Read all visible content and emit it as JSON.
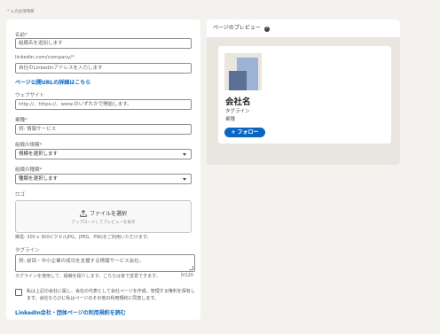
{
  "required_note": "* 入力必須項目",
  "form": {
    "name_label": "名前*",
    "name_placeholder": "組織名を追加します",
    "url_label": "linkedin.com/company/*",
    "url_placeholder": "自社のLinkedInアドレスを入力します",
    "url_details_link": "ページ公開URLの詳細はこちら",
    "website_label": "ウェブサイト",
    "website_placeholder": "http://、https://、www.のいずれかで開始します。",
    "industry_label": "業種*",
    "industry_placeholder": "例: 情報サービス",
    "size_label": "組織の規模*",
    "size_value": "規模を選択します",
    "type_label": "組織の種類*",
    "type_value": "種類を選択します",
    "logo_label": "ロゴ",
    "upload_button": "ファイルを選択",
    "upload_subtext": "アップロードしてプレビューを表示",
    "logo_hint": "推奨: 300 x 300ピクセルJPG、JPEG、PNGをご利用いただけます。",
    "tagline_label": "タグライン",
    "tagline_placeholder": "例: 前田・中小企業の成功を支援する情報サービス会社。",
    "tagline_hint": "タグラインを使用して、組織を紹介します。こちらは後で変更できます。",
    "tagline_counter": "0/120",
    "terms_text": "私は上記の会社に属し、会社の代表として会社ページを作成、管理する権利を保有します。会社ならびに私はページのその他の利用規約に同意します。",
    "terms_link": "LinkedIn会社・団体ページの利用規約を読む"
  },
  "preview": {
    "title": "ページのプレビュー",
    "help_icon": "?",
    "company_name": "会社名",
    "tagline": "タグライン",
    "industry": "業種",
    "follow_button": "+ フォロー"
  },
  "colors": {
    "accent": "#0a66c2",
    "background": "#f3f2ef",
    "logo_light": "#9db3d6",
    "logo_dark": "#5b7096"
  },
  "icons": [
    "upload-icon",
    "help-icon",
    "chevron-down-icon"
  ]
}
